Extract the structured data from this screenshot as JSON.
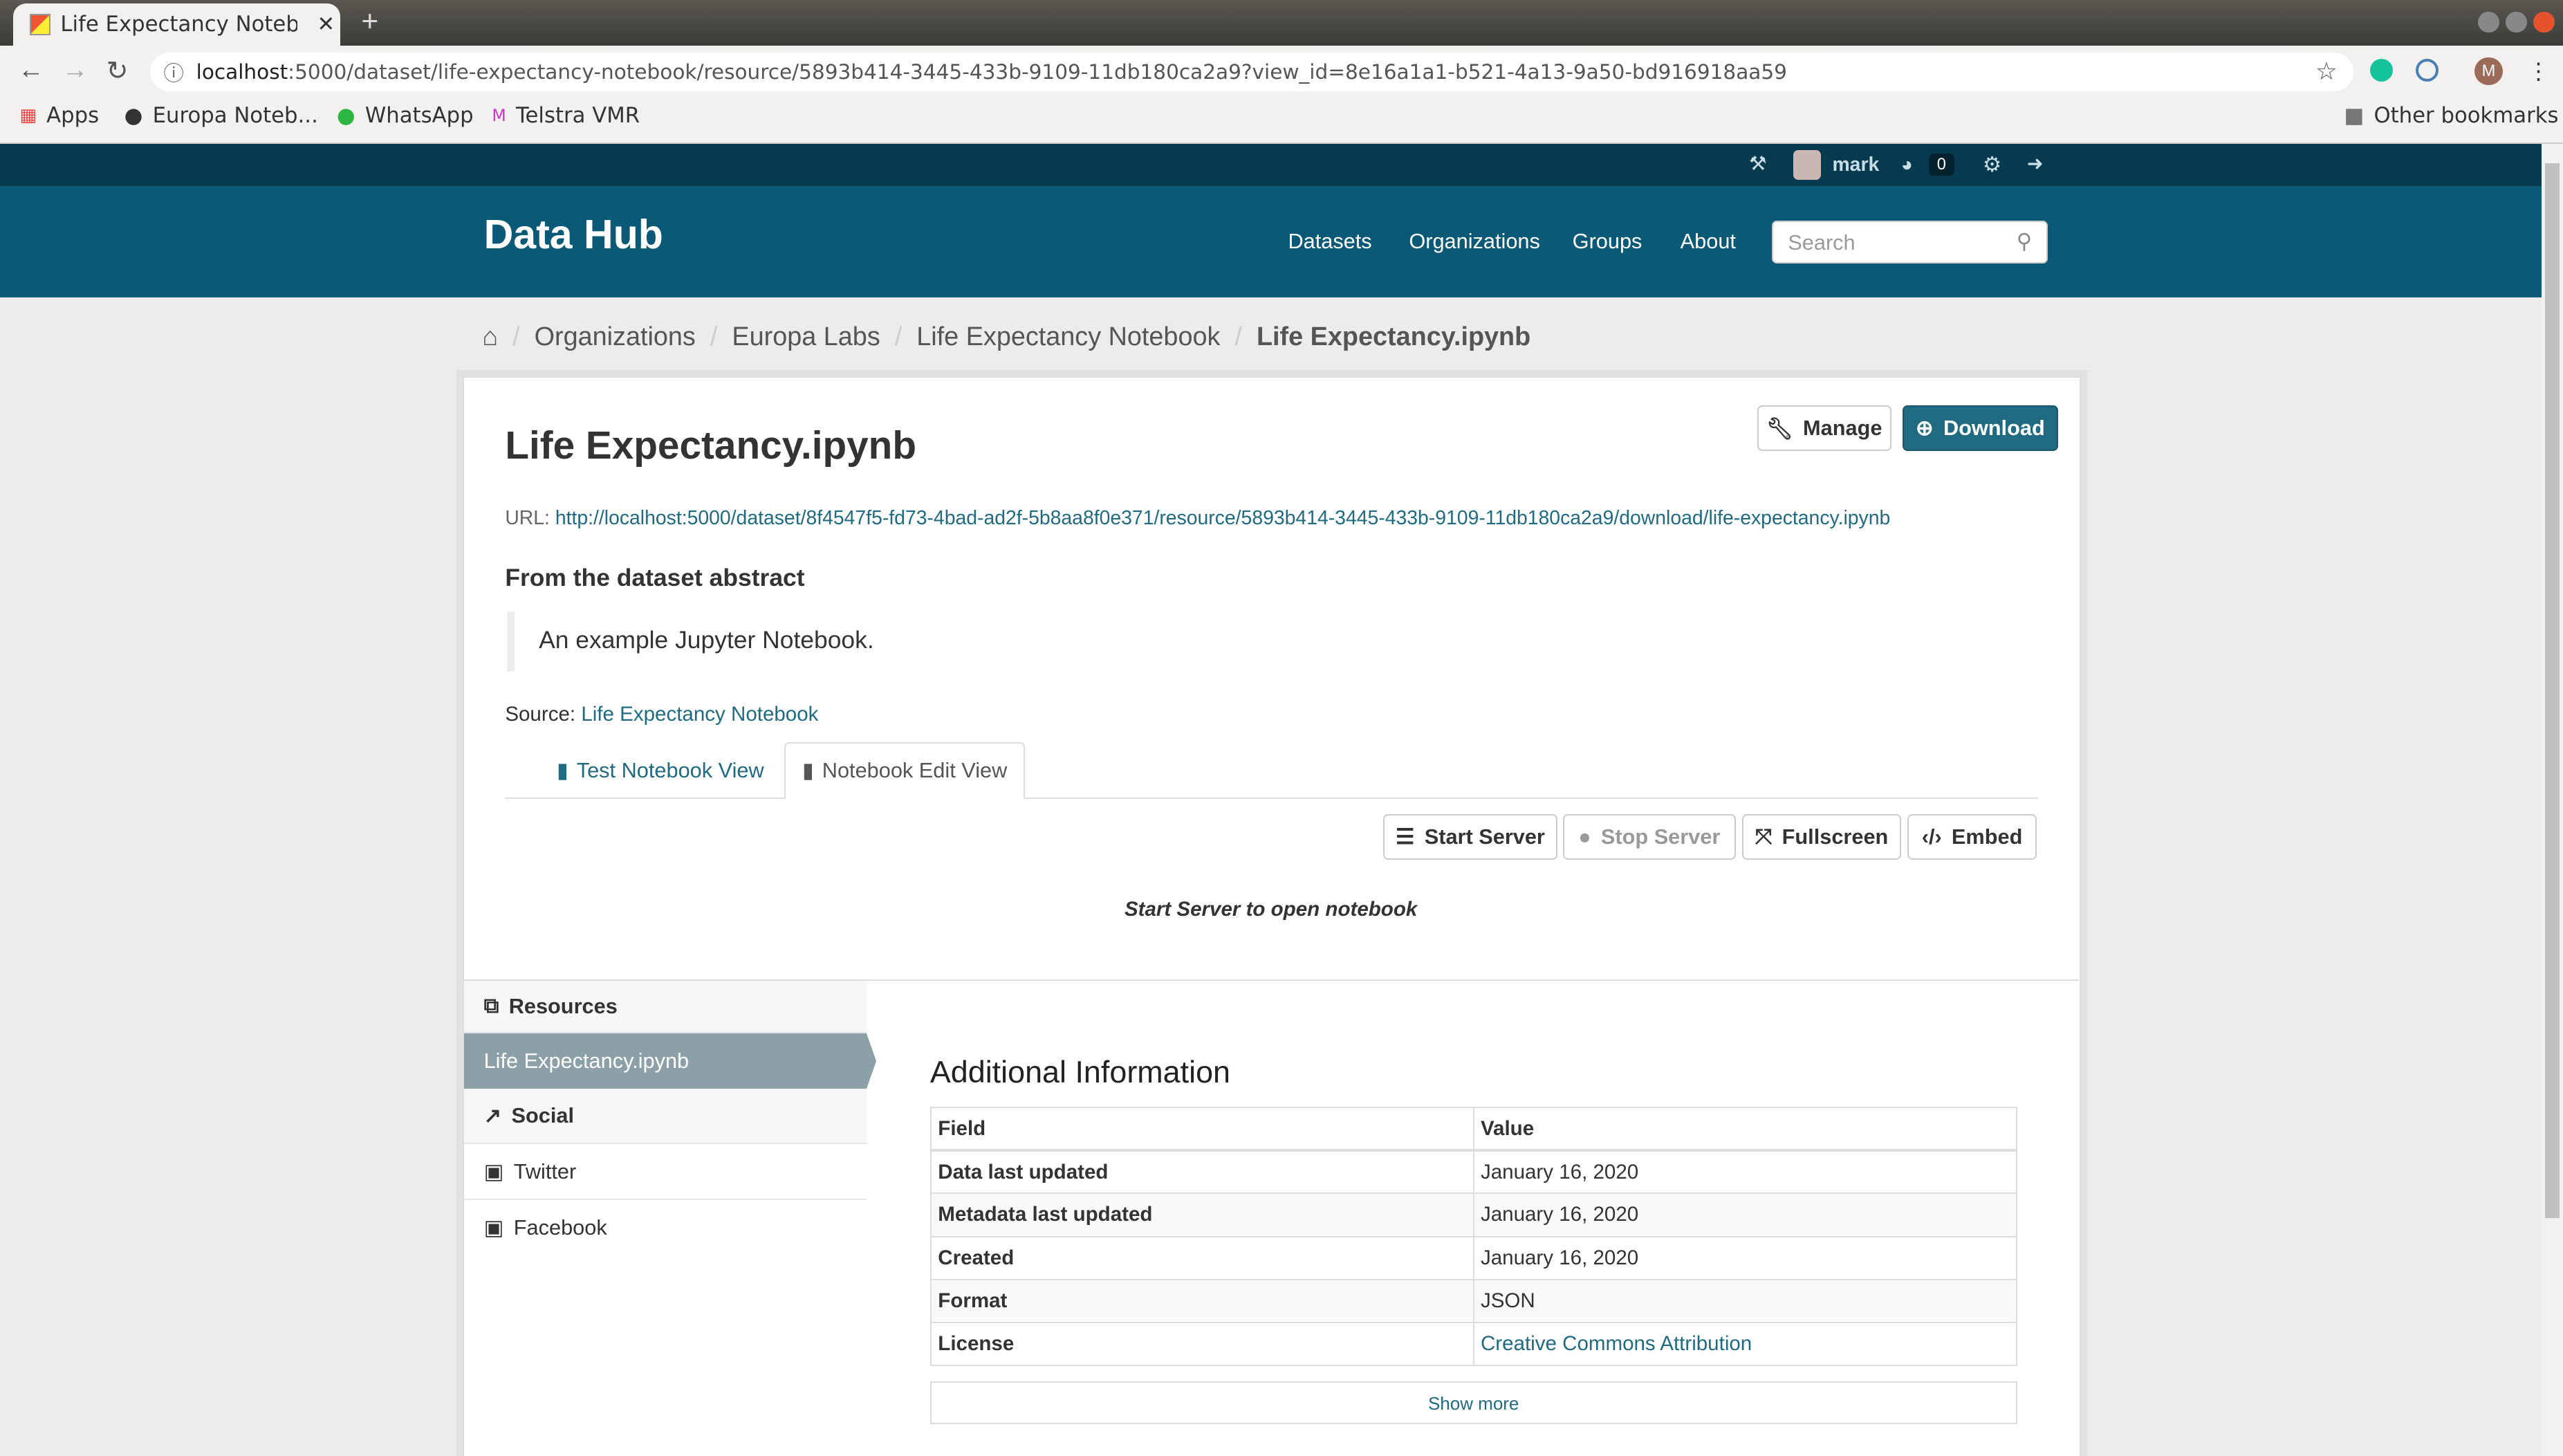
{
  "browser": {
    "tab_title": "Life Expectancy Notebook",
    "url_host": "localhost",
    "url_rest": ":5000/dataset/life-expectancy-notebook/resource/5893b414-3445-433b-9109-11db180ca2a9?view_id=8e16a1a1-b521-4a13-9a50-bd916918aa59",
    "bookmarks": [
      "Apps",
      "Europa Noteb...",
      "WhatsApp",
      "Telstra VMR"
    ],
    "other_bookmarks": "Other bookmarks",
    "profile_initial": "M"
  },
  "account": {
    "username": "mark",
    "activity_count": "0"
  },
  "header": {
    "logo": "Data Hub",
    "nav": [
      "Datasets",
      "Organizations",
      "Groups",
      "About"
    ],
    "search_placeholder": "Search"
  },
  "breadcrumb": [
    "Organizations",
    "Europa Labs",
    "Life Expectancy Notebook",
    "Life Expectancy.ipynb"
  ],
  "resource": {
    "title": "Life Expectancy.ipynb",
    "manage_label": "Manage",
    "download_label": "Download",
    "url_label": "URL:",
    "url": "http://localhost:5000/dataset/8f4547f5-fd73-4bad-ad2f-5b8aa8f0e371/resource/5893b414-3445-433b-9109-11db180ca2a9/download/life-expectancy.ipynb",
    "abstract_heading": "From the dataset abstract",
    "abstract": "An example Jupyter Notebook.",
    "source_label": "Source:",
    "source_link": "Life Expectancy Notebook"
  },
  "views": {
    "tabs": [
      "Test Notebook View",
      "Notebook Edit View"
    ],
    "active": 1,
    "buttons": [
      "Start Server",
      "Stop Server",
      "Fullscreen",
      "Embed"
    ],
    "message": "Start Server to open notebook"
  },
  "sidebar": {
    "resources_heading": "Resources",
    "resources": [
      "Life Expectancy.ipynb"
    ],
    "social_heading": "Social",
    "social": [
      "Twitter",
      "Facebook"
    ]
  },
  "additional": {
    "heading": "Additional Information",
    "columns": [
      "Field",
      "Value"
    ],
    "rows": [
      [
        "Data last updated",
        "January 16, 2020"
      ],
      [
        "Metadata last updated",
        "January 16, 2020"
      ],
      [
        "Created",
        "January 16, 2020"
      ],
      [
        "Format",
        "JSON"
      ],
      [
        "License",
        "Creative Commons Attribution"
      ]
    ],
    "show_more": "Show more"
  },
  "colors": {
    "masthead": "#0a5977",
    "accent": "#206b82"
  }
}
